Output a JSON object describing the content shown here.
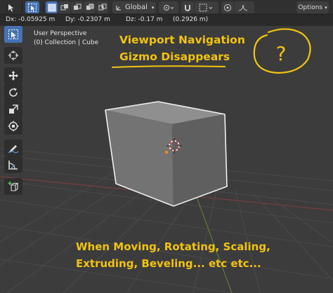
{
  "header": {
    "orientation_label": "Global",
    "options_label": "Options"
  },
  "transform_info": {
    "dx": "Dx: -0.05925 m",
    "dy": "Dy: -0.2307 m",
    "dz": "Dz: -0.17 m",
    "distance": "(0.2926 m)"
  },
  "viewport": {
    "perspective": "User Perspective",
    "collection": "(0) Collection | Cube"
  },
  "annotations": {
    "title_line1": "Viewport Navigation",
    "title_line2": "Gizmo Disappears",
    "question_mark": "?",
    "bottom_line1": "When Moving, Rotating, Scaling,",
    "bottom_line2": "Extruding, Beveling... etc etc..."
  },
  "toolbar": {
    "tools": [
      "select-tool",
      "cursor-tool",
      "move-tool",
      "rotate-tool",
      "scale-tool",
      "transform-tool",
      "annotate-tool",
      "measure-tool",
      "add-cube-tool"
    ],
    "active": "select-tool"
  },
  "colors": {
    "accent": "#4772b3",
    "annotation": "#f2c311",
    "viewport_bg": "#3c3c3c"
  }
}
